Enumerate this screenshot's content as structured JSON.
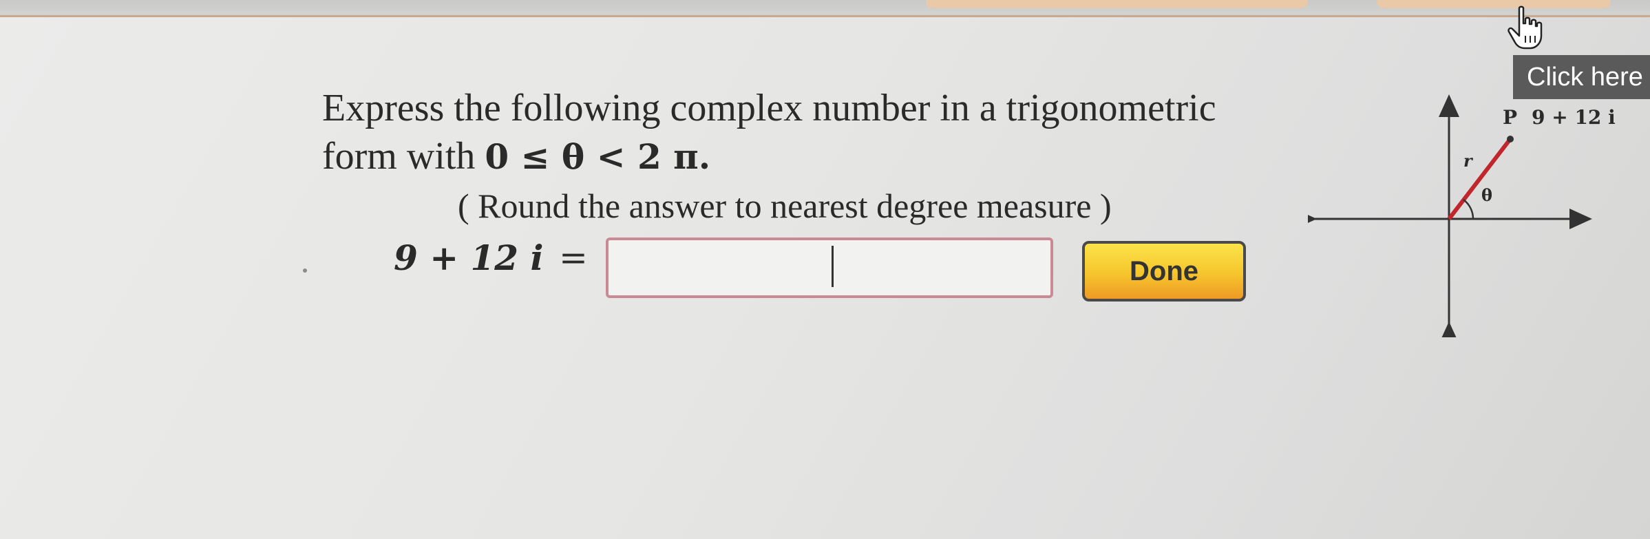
{
  "question": {
    "text_prefix": "Express the following complex number in a trigonometric form with",
    "condition": "0 ≤ θ < 2 π.",
    "note": "( Round the answer to nearest degree measure )"
  },
  "equation": {
    "lhs": "9 + 12 i",
    "equals": "=",
    "input_value": "",
    "input_placeholder": ""
  },
  "buttons": {
    "done_label": "Done",
    "click_here_label": "Click here"
  },
  "diagram": {
    "point_label": "P",
    "complex_label": "9 + 12 i",
    "r_label": "r",
    "theta_label": "θ",
    "line_color": "#c0262b"
  },
  "colors": {
    "done_gradient_top": "#fbe34a",
    "done_gradient_bottom": "#ee9a25",
    "input_border": "#c98a93",
    "click_here_bg": "#5a5a5a"
  },
  "icons": {
    "cursor": "hand-pointer-icon"
  }
}
